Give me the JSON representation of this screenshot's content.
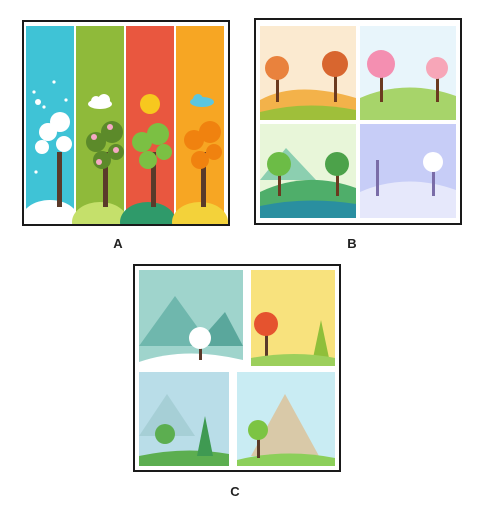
{
  "panels": [
    {
      "id": "A",
      "label": "A",
      "theme": "four vertical season strips with trees (winter, spring, summer, autumn)"
    },
    {
      "id": "B",
      "label": "B",
      "theme": "four square season landscapes (autumn, spring, summer, winter)"
    },
    {
      "id": "C",
      "label": "C",
      "theme": "four season landscapes with mountains (winter, autumn, spring, summer)"
    }
  ],
  "colors": {
    "winter_strip": "#3fc3d6",
    "spring_strip": "#8fba3a",
    "summer_strip": "#e9573f",
    "autumn_strip": "#f7a623",
    "frame": "#1a1a1a"
  },
  "icons": [
    "tree-icon",
    "sun-icon",
    "cloud-icon",
    "snowflake-icon",
    "leaf-icon",
    "mountain-icon"
  ]
}
